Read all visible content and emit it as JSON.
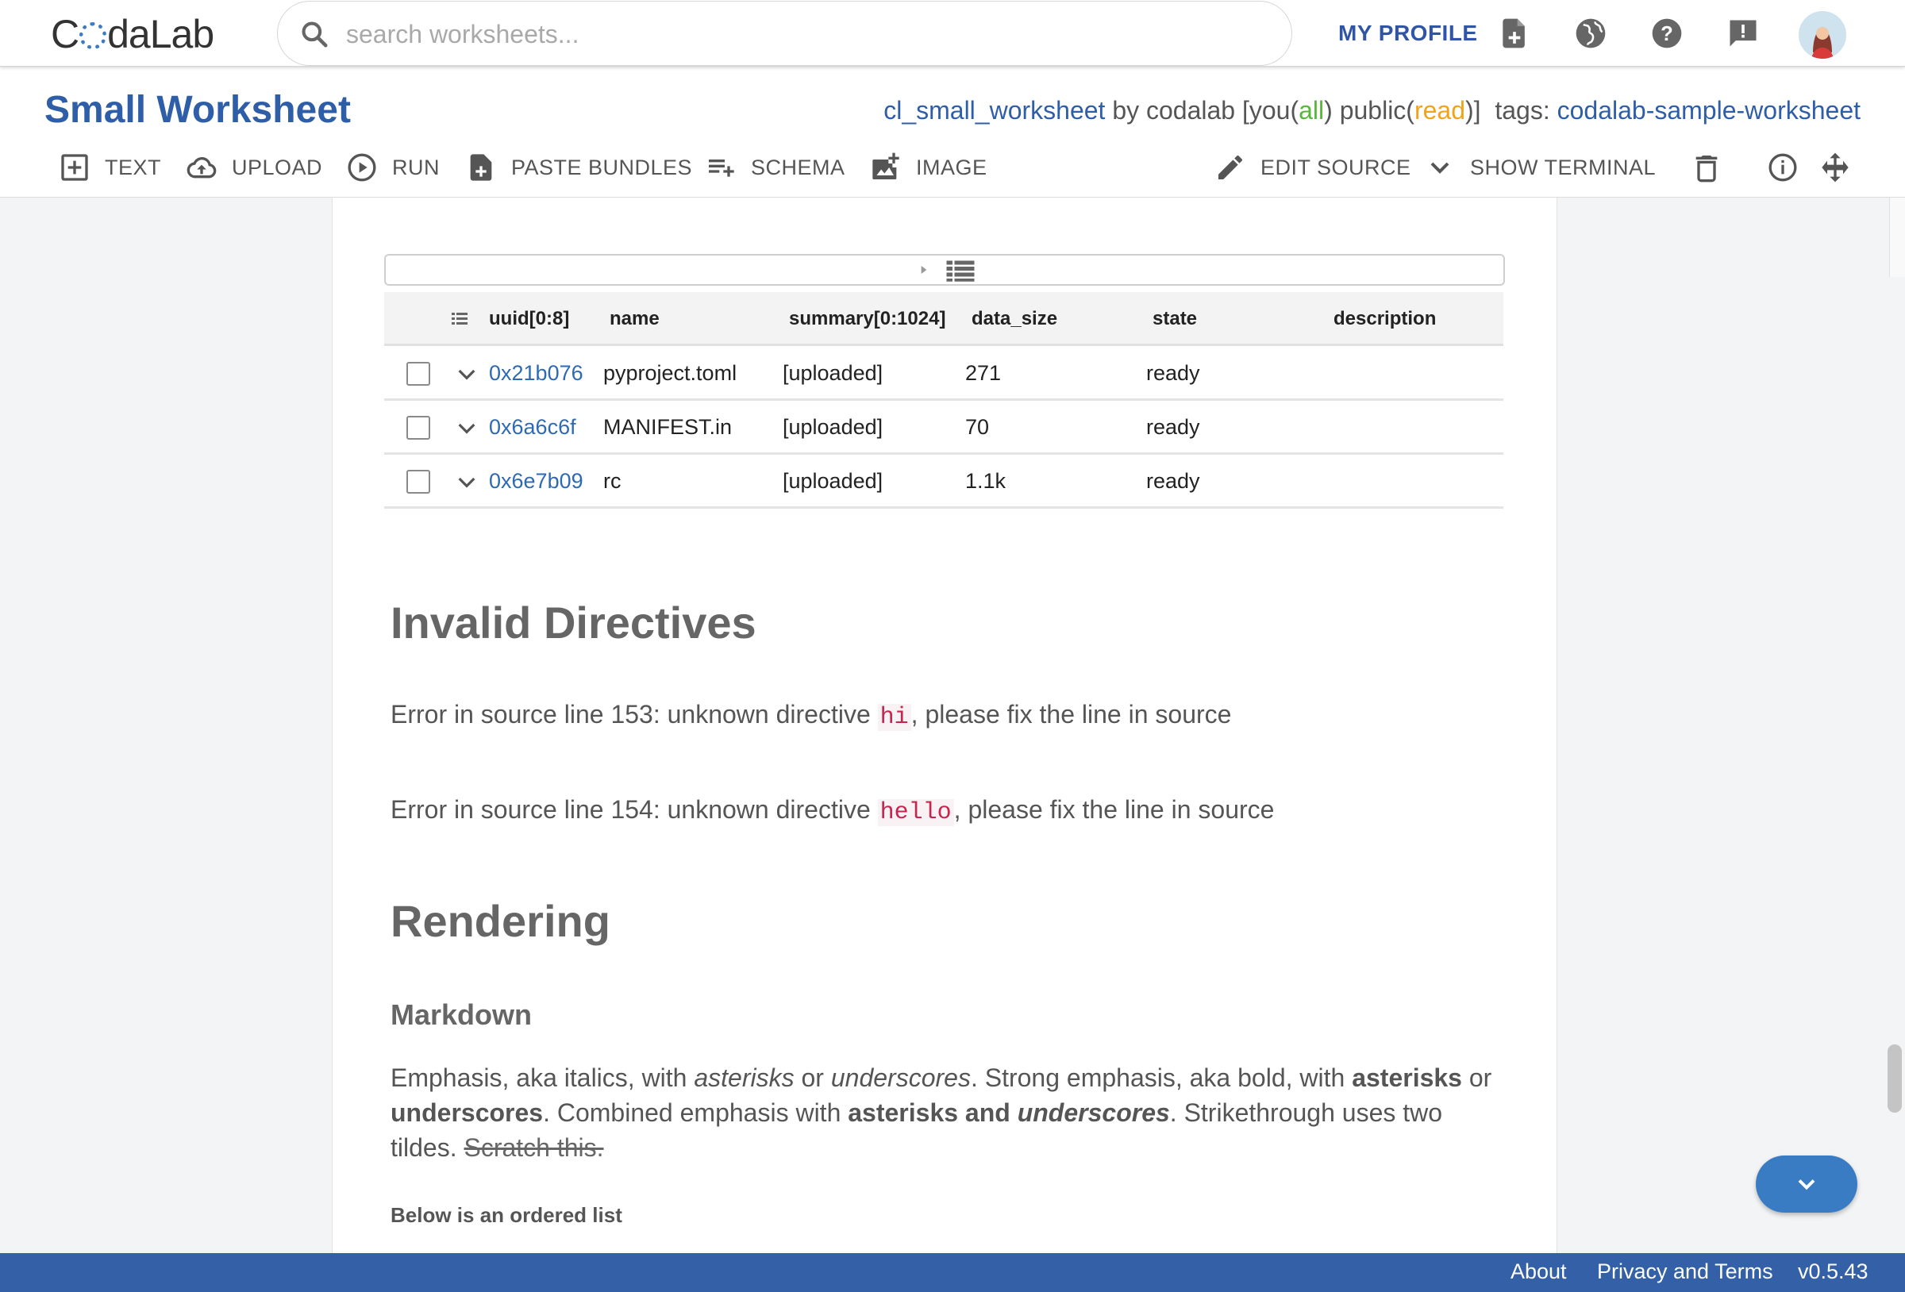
{
  "nav": {
    "logo": "CodaLab",
    "logo_prefix": "C",
    "logo_suffix": "daLab",
    "search_placeholder": "search worksheets...",
    "my_profile": "MY PROFILE",
    "icons": [
      "new-worksheet-icon",
      "public-icon",
      "help-icon",
      "feedback-icon",
      "avatar"
    ]
  },
  "worksheet": {
    "title": "Small Worksheet",
    "name": "cl_small_worksheet",
    "by": " by codalab [you(",
    "you_perm": "all",
    "public_prefix": ") public(",
    "public_perm": "read",
    "suffix": ")]  tags: ",
    "tag": "codalab-sample-worksheet"
  },
  "toolbar": {
    "text": "TEXT",
    "upload": "UPLOAD",
    "run": "RUN",
    "paste_bundles": "PASTE BUNDLES",
    "schema": "SCHEMA",
    "image": "IMAGE",
    "edit_source": "EDIT SOURCE",
    "show_terminal": "SHOW TERMINAL"
  },
  "table": {
    "columns": [
      "uuid[0:8]",
      "name",
      "summary[0:1024]",
      "data_size",
      "state",
      "description"
    ],
    "rows": [
      {
        "uuid": "0x21b076",
        "name": "pyproject.toml",
        "summary": "[uploaded]",
        "data_size": "271",
        "state": "ready",
        "description": ""
      },
      {
        "uuid": "0x6a6c6f",
        "name": "MANIFEST.in",
        "summary": "[uploaded]",
        "data_size": "70",
        "state": "ready",
        "description": ""
      },
      {
        "uuid": "0x6e7b09",
        "name": "rc",
        "summary": "[uploaded]",
        "data_size": "1.1k",
        "state": "ready",
        "description": ""
      }
    ]
  },
  "content": {
    "invalid_heading": "Invalid Directives",
    "err1_pre": "Error in source line 153: unknown directive ",
    "err1_code": "hi",
    "err1_post": ", please fix the line in source",
    "err2_pre": "Error in source line 154: unknown directive ",
    "err2_code": "hello",
    "err2_post": ", please fix the line in source",
    "rendering_heading": "Rendering",
    "markdown_heading": "Markdown",
    "p1": "Emphasis, aka italics, with ",
    "p2": "asterisks",
    "p3": " or ",
    "p4": "underscores",
    "p5": ". Strong emphasis, aka bold, with ",
    "p6": "asterisks",
    "p7": " or ",
    "p8": "underscores",
    "p9": ". Combined emphasis with ",
    "p10": "asterisks and ",
    "p11": "underscores",
    "p12": ". Strikethrough uses two tildes. ",
    "p13": "Scratch this.",
    "ordered_list_label": "Below is an ordered list"
  },
  "footer": {
    "about": "About",
    "privacy": "Privacy and Terms",
    "version": "v0.5.43"
  },
  "colors": {
    "brand_blue": "#2f5ea8",
    "footer_blue": "#3360a6",
    "link_blue": "#2e6ab3",
    "perm_green": "#58b63a",
    "perm_orange": "#f1a31b",
    "code_red": "#c7254e"
  }
}
